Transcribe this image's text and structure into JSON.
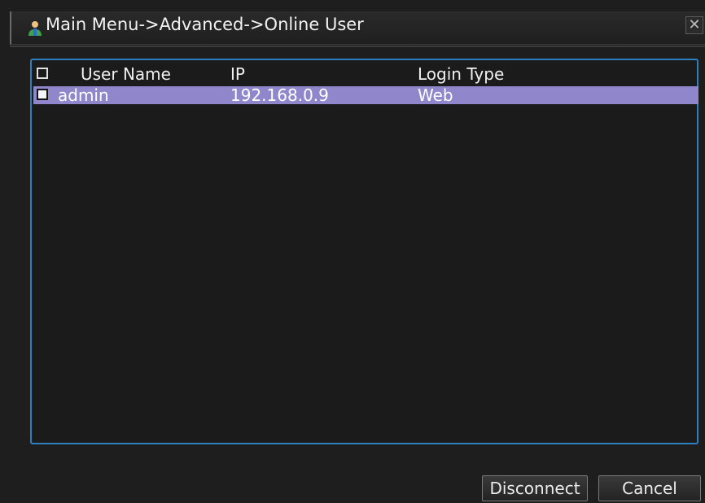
{
  "window": {
    "title": "Main Menu->Advanced->Online User",
    "close_symbol": "✕",
    "icon": "user-icon"
  },
  "user_list": {
    "columns": [
      "User Name",
      "IP",
      "Login Type"
    ],
    "rows": [
      {
        "user_name": "admin",
        "ip": "192.168.0.9",
        "login_type": "Web",
        "selected": true
      }
    ]
  },
  "buttons": {
    "disconnect": "Disconnect",
    "cancel": "Cancel"
  },
  "colors": {
    "accent_border": "#2f7fbf",
    "selected_row": "#8f86cc"
  }
}
